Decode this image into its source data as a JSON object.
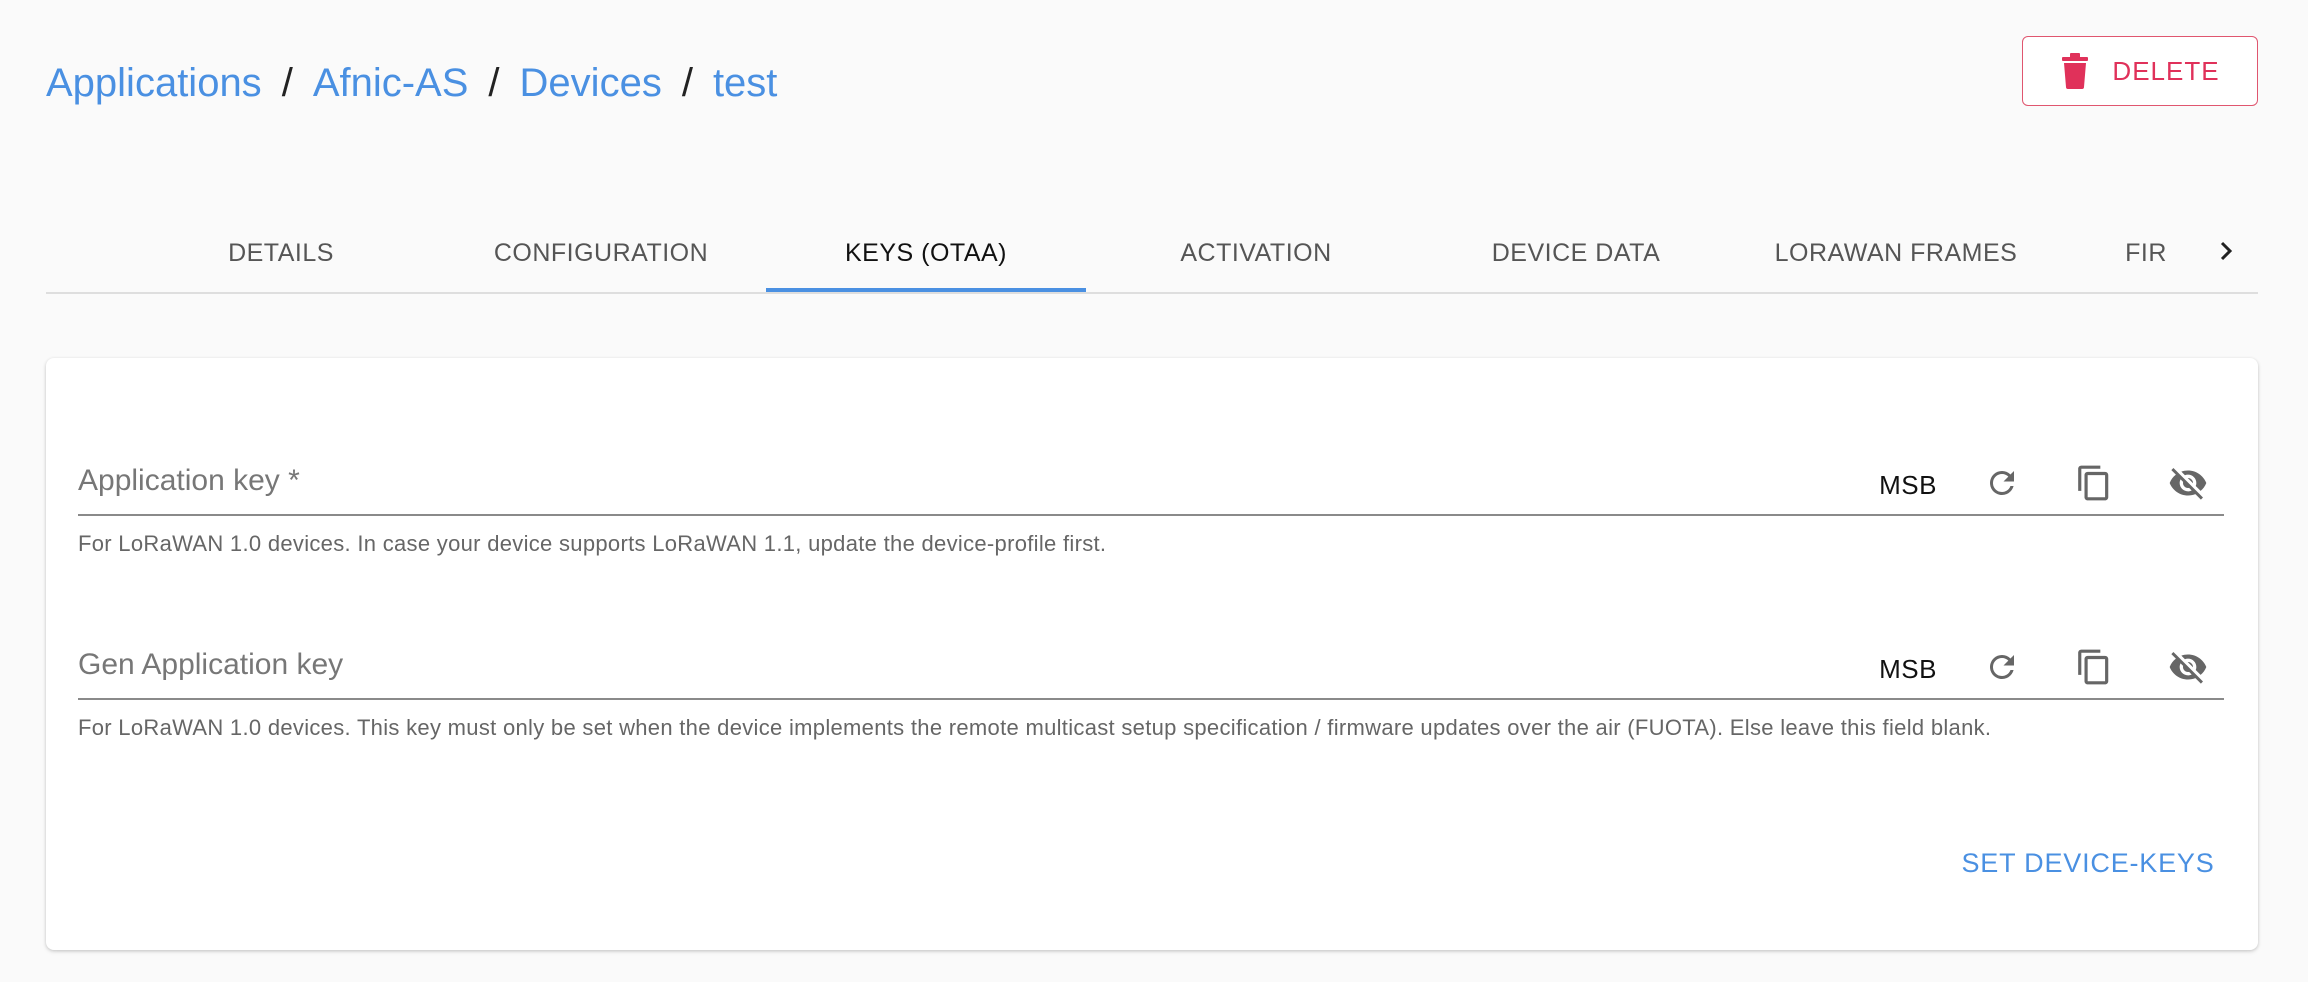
{
  "breadcrumb": {
    "items": [
      "Applications",
      "Afnic-AS",
      "Devices",
      "test"
    ],
    "separator": "/"
  },
  "header": {
    "delete_label": "DELETE",
    "delete_icon": "trash-icon"
  },
  "tabs": {
    "items": [
      {
        "label": "DETAILS",
        "active": false
      },
      {
        "label": "CONFIGURATION",
        "active": false
      },
      {
        "label": "KEYS (OTAA)",
        "active": true
      },
      {
        "label": "ACTIVATION",
        "active": false
      },
      {
        "label": "DEVICE DATA",
        "active": false
      },
      {
        "label": "LORAWAN FRAMES",
        "active": false
      },
      {
        "label": "FIR",
        "active": false
      }
    ],
    "scroll_icon": "chevron-right-icon"
  },
  "form": {
    "app_key": {
      "label": "Application key *",
      "value": "",
      "byte_order": "MSB",
      "helper": "For LoRaWAN 1.0 devices. In case your device supports LoRaWAN 1.1, update the device-profile first."
    },
    "gen_app_key": {
      "label": "Gen Application key",
      "value": "",
      "byte_order": "MSB",
      "helper": "For LoRaWAN 1.0 devices. This key must only be set when the device implements the remote multicast setup specification / firmware updates over the air (FUOTA). Else leave this field blank."
    },
    "submit_label": "SET DEVICE-KEYS"
  },
  "colors": {
    "accent": "#4a90e2",
    "danger": "#e0315a",
    "background": "#fafafa"
  }
}
